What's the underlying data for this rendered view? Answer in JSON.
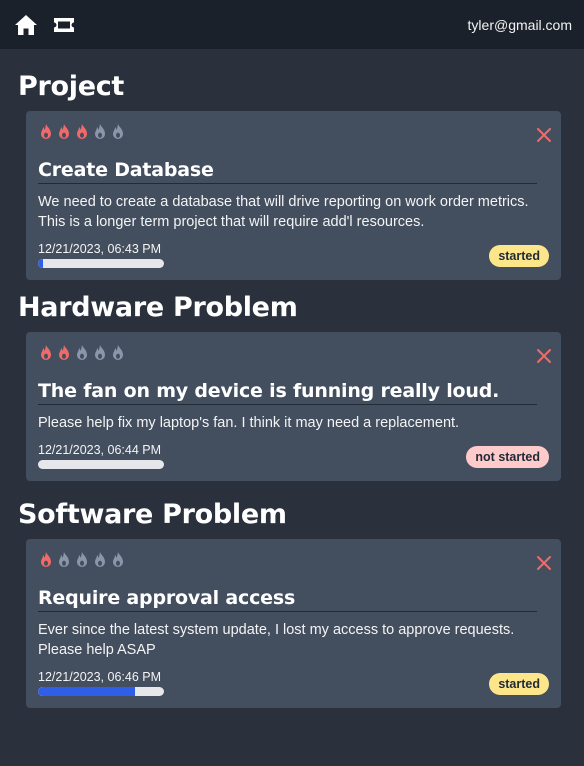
{
  "header": {
    "home_icon": "home-icon",
    "ticket_icon": "ticket-icon",
    "email": "tyler@gmail.com"
  },
  "colors": {
    "flame_active": "#f06a6a",
    "flame_inactive": "#8a97ab",
    "progress_fill": "#2f5ee8",
    "badge_started": "#fde68a",
    "badge_not_started": "#fecaca",
    "close": "#f06a6a"
  },
  "sections": [
    {
      "title": "Project",
      "ticket": {
        "priority": 3,
        "priority_max": 5,
        "title": "Create Database",
        "description": " We need to create a database that will drive reporting on work order metrics. This is a longer term project that will require add'l resources.",
        "date": "12/21/2023, 06:43 PM",
        "progress": 0.04,
        "status": "started"
      }
    },
    {
      "title": "Hardware Problem",
      "ticket": {
        "priority": 2,
        "priority_max": 5,
        "title": "The fan on my device is funning really loud.",
        "description": " Please help fix my laptop's fan. I think it may need a replacement.",
        "date": "12/21/2023, 06:44 PM",
        "progress": 0,
        "status": "not started"
      }
    },
    {
      "title": "Software Problem",
      "ticket": {
        "priority": 1,
        "priority_max": 5,
        "title": "Require approval access",
        "description": " Ever since the latest system update, I lost my access to approve requests. Please help ASAP",
        "date": "12/21/2023, 06:46 PM",
        "progress": 0.77,
        "status": "started"
      }
    }
  ]
}
